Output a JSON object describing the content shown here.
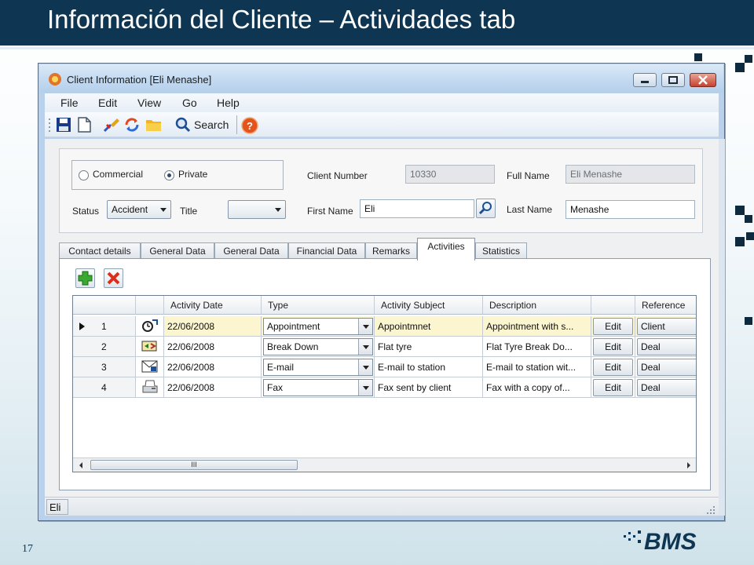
{
  "slide": {
    "title": "Información del Cliente – Actividades tab",
    "page_number": "17",
    "logo_text": "BMS",
    "colors": {
      "header": "#0e3551",
      "accent": "#0e2a3e"
    }
  },
  "window": {
    "title": "Client Information [Eli Menashe]",
    "icon": "app-logo-icon",
    "controls": [
      "minimize-icon",
      "maximize-icon",
      "close-icon"
    ]
  },
  "menu": {
    "items": [
      "File",
      "Edit",
      "View",
      "Go",
      "Help"
    ]
  },
  "toolbar": {
    "icons": [
      "save-icon",
      "new-icon",
      "clear-icon",
      "refresh-icon",
      "folder-icon",
      "search-icon",
      "help-icon"
    ],
    "search_label": "Search"
  },
  "header": {
    "client_type": {
      "options": [
        "Commercial",
        "Private"
      ],
      "selected": "Private"
    },
    "status_label": "Status",
    "status_value": "Accident",
    "title_label": "Title",
    "title_value": "",
    "client_number_label": "Client Number",
    "client_number_value": "10330",
    "full_name_label": "Full Name",
    "full_name_value": "Eli Menashe",
    "first_name_label": "First Name",
    "first_name_value": "Eli",
    "last_name_label": "Last Name",
    "last_name_value": "Menashe"
  },
  "tabs": {
    "items": [
      "Contact details",
      "General Data",
      "General Data",
      "Financial Data",
      "Remarks",
      "Activities",
      "Statistics"
    ],
    "active": "Activities"
  },
  "activities": {
    "columns": [
      "",
      "",
      "Activity Date",
      "Type",
      "Activity Subject",
      "Description",
      "",
      "Reference"
    ],
    "rows": [
      {
        "num": "1",
        "icon": "appointment-icon",
        "date": "22/06/2008",
        "type": "Appointment",
        "subject": "Appointmnet",
        "description": "Appointment with s...",
        "action": "Edit",
        "reference": "Client",
        "selected": true
      },
      {
        "num": "2",
        "icon": "breakdown-icon",
        "date": "22/06/2008",
        "type": "Break Down",
        "subject": "Flat tyre",
        "description": "Flat Tyre Break Do...",
        "action": "Edit",
        "reference": "Deal",
        "selected": false
      },
      {
        "num": "3",
        "icon": "email-icon",
        "date": "22/06/2008",
        "type": "E-mail",
        "subject": "E-mail to station",
        "description": "E-mail to station wit...",
        "action": "Edit",
        "reference": "Deal",
        "selected": false
      },
      {
        "num": "4",
        "icon": "fax-icon",
        "date": "22/06/2008",
        "type": "Fax",
        "subject": "Fax sent by client",
        "description": "Fax with a copy of...",
        "action": "Edit",
        "reference": "Deal",
        "selected": false
      }
    ],
    "scroll_thumb_label": "III"
  },
  "statusbar": {
    "text": "Eli"
  }
}
